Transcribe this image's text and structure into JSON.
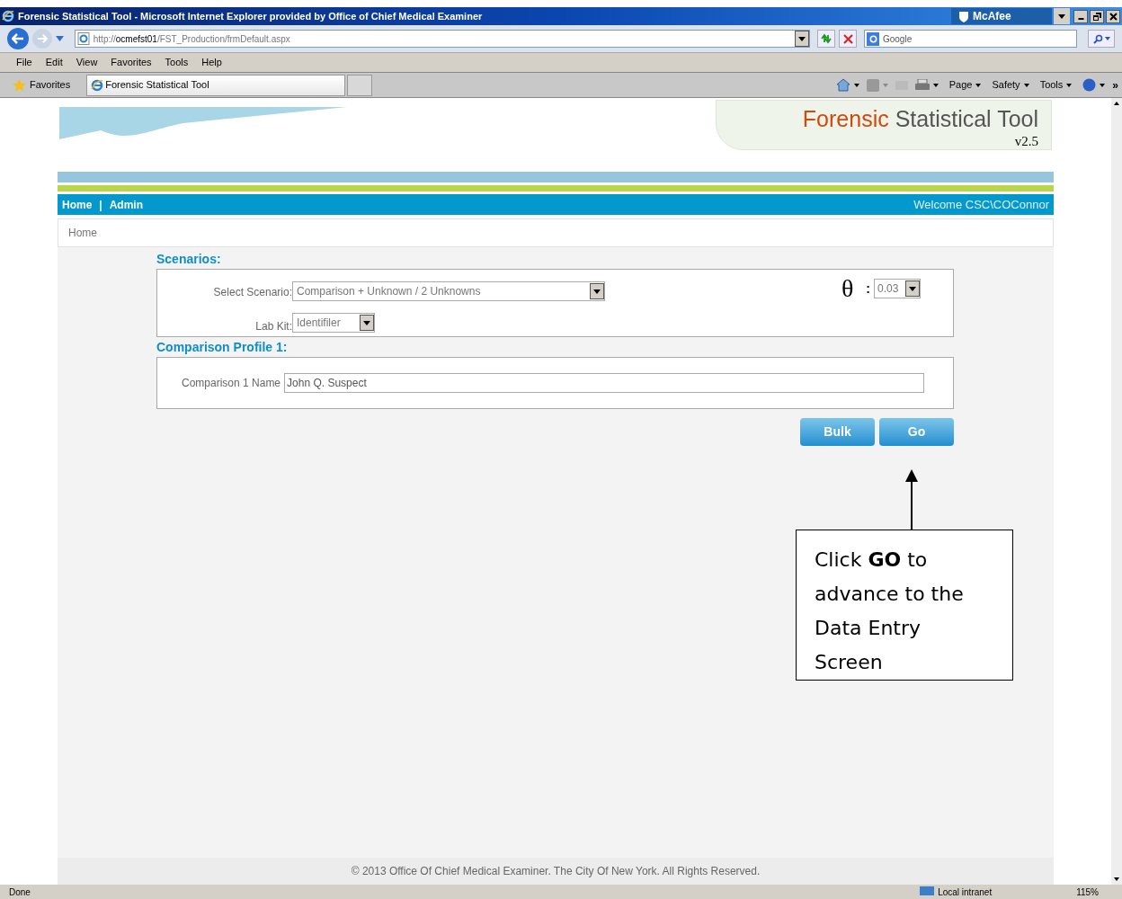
{
  "window": {
    "title": "Forensic Statistical Tool - Microsoft Internet Explorer provided by Office of Chief Medical Examiner",
    "addon": "McAfee"
  },
  "address": {
    "scheme": "http://",
    "host": "ocmefst01",
    "path": "/FST_Production/frmDefault.aspx"
  },
  "search": {
    "placeholder": "Google"
  },
  "menu": [
    "File",
    "Edit",
    "View",
    "Favorites",
    "Tools",
    "Help"
  ],
  "favorites": {
    "label": "Favorites",
    "tab": "Forensic Statistical Tool",
    "commands": [
      "Page",
      "Safety",
      "Tools"
    ],
    "more": "»"
  },
  "page": {
    "logo": {
      "first": "Forensic",
      "rest": "Statistical Tool",
      "version": "v2.5"
    },
    "nav": [
      "Home",
      "Admin"
    ],
    "nav_separator": "|",
    "welcome": "Welcome CSC\\COConnor",
    "breadcrumb": "Home",
    "scenarios": {
      "title": "Scenarios:",
      "scenario_label": "Select Scenario:",
      "scenario_value": "Comparison + Unknown / 2 Unknowns",
      "theta": "θ",
      "theta_colon": ":",
      "theta_value": "0.03",
      "labkit_label": "Lab Kit:",
      "labkit_value": "Identifiler"
    },
    "comparison": {
      "title": "Comparison Profile 1:",
      "name_label": "Comparison 1 Name",
      "name_value": "John Q. Suspect"
    },
    "buttons": [
      "Bulk",
      "Go"
    ],
    "footer": "© 2013 Office Of Chief Medical Examiner. The City Of New York. All Rights Reserved."
  },
  "callout": {
    "lines": [
      "Click **GO** to",
      "advance to the",
      "Data Entry",
      "Screen"
    ]
  },
  "status_bar": {
    "text": "Done",
    "zone": "Local intranet",
    "zoom": "115%"
  }
}
